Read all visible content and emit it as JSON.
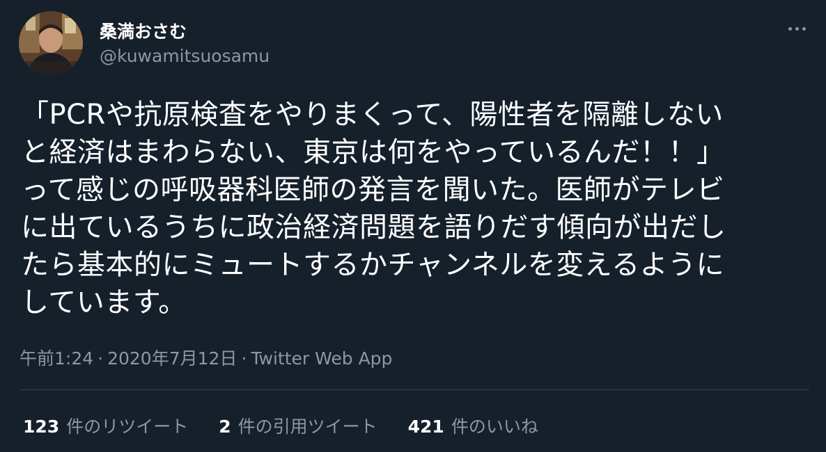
{
  "user": {
    "display_name": "桑満おさむ",
    "handle": "@kuwamitsuosamu"
  },
  "tweet": {
    "lines": [
      "「PCRや抗原検査をやりまくって、陽性者を隔離しない",
      "と経済はまわらない、東京は何をやっているんだ！！」",
      "って感じの呼吸器科医師の発言を聞いた。医師がテレビ",
      "に出ているうちに政治経済問題を語りだす傾向が出だし",
      "たら基本的にミュートするかチャンネルを変えるように",
      "しています。"
    ],
    "time": "午前1:24",
    "date": "2020年7月12日",
    "separator": "·",
    "source": "Twitter Web App"
  },
  "stats": {
    "retweets": {
      "count": "123",
      "label": "件のリツイート"
    },
    "quotes": {
      "count": "2",
      "label": "件の引用ツイート"
    },
    "likes": {
      "count": "421",
      "label": "件のいいね"
    }
  },
  "icons": {
    "more": "more-horizontal-icon",
    "avatar": "profile-photo"
  },
  "colors": {
    "background": "#15202b",
    "primary_text": "#ffffff",
    "secondary_text": "#8b98a5",
    "divider": "#38444d"
  }
}
